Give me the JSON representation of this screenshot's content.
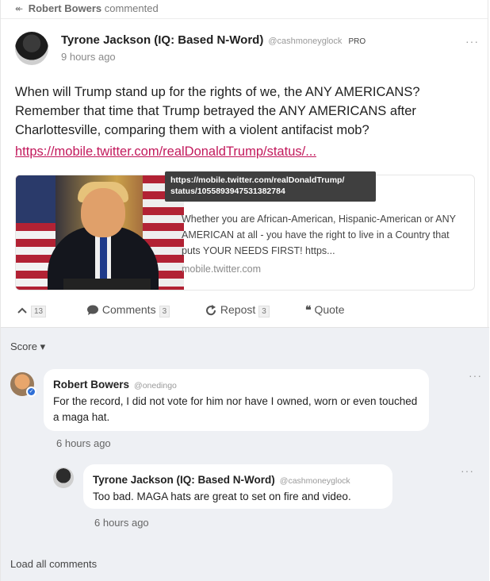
{
  "commented_bar": {
    "arrow": "↞",
    "name": "Robert Bowers",
    "action": "commented"
  },
  "post": {
    "author": "Tyrone Jackson (IQ: Based N-Word)",
    "handle": "@cashmoneyglock",
    "badge": "PRO",
    "time": "9 hours ago",
    "more": "···",
    "text": "When will Trump stand up for the rights of we, the ANY AMERICANS? Remember that time that Trump betrayed the ANY AMERICANS after Charlottesville, comparing them with a violent antifacist mob?",
    "link": "https://mobile.twitter.com/realDonaldTrump/status/..."
  },
  "preview": {
    "tooltip_line1": "https://mobile.twitter.com/realDonaldTrump/",
    "tooltip_line2": "status/1055893947531382784",
    "description": "Whether you are African-American, Hispanic-American or ANY AMERICAN at all - you have the right to live in a Country that puts YOUR NEEDS FIRST! https...",
    "domain": "mobile.twitter.com"
  },
  "actions": {
    "upvote_icon": "chevron-up-icon",
    "upvote_count": "13",
    "comments_label": "Comments",
    "comments_count": "3",
    "repost_label": "Repost",
    "repost_count": "3",
    "quote_label": "Quote"
  },
  "comments": {
    "sort_label": "Score",
    "sort_arrow": "▾",
    "items": [
      {
        "author": "Robert Bowers",
        "handle": "@onedingo",
        "text": "For the record, I did not vote for him nor have I owned, worn or even touched a maga hat.",
        "time": "6 hours ago"
      },
      {
        "author": "Tyrone Jackson (IQ: Based N-Word)",
        "handle": "@cashmoneyglock",
        "text": "Too bad. MAGA hats are great to set on fire and video.",
        "time": "6 hours ago"
      }
    ],
    "load_all": "Load all comments"
  },
  "colors": {
    "link": "#c2185b",
    "comments_bg": "#eef0f4",
    "verified": "#2f6fd6"
  }
}
